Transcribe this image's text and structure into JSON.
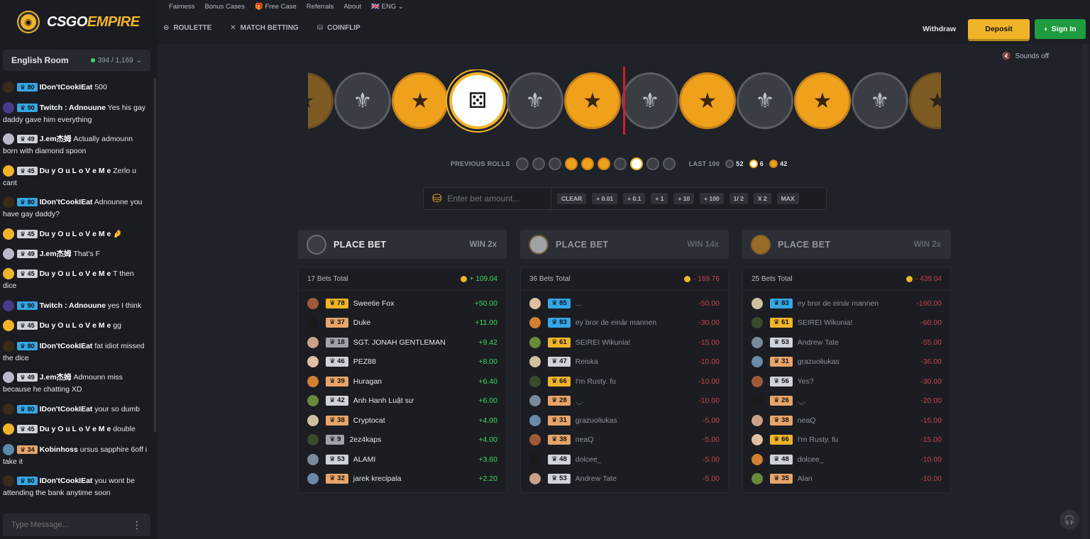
{
  "brand": {
    "name_a": "CSGO",
    "name_b": "EMPIRE"
  },
  "toplinks": [
    "Fairness",
    "Bonus Cases",
    "Free Case",
    "Referrals",
    "About",
    "ENG"
  ],
  "nav": {
    "roulette": "ROULETTE",
    "match_betting": "MATCH BETTING",
    "coinflip": "COINFLIP"
  },
  "header": {
    "withdraw": "Withdraw",
    "deposit": "Deposit",
    "signin": "Sign In"
  },
  "sounds": "Sounds off",
  "room": {
    "name": "English Room",
    "count": "394 / 1,169"
  },
  "chat": [
    {
      "level": "80",
      "badge_color": "#35a7e6",
      "user": "IDon'tCookIEat",
      "text": "500"
    },
    {
      "level": "90",
      "badge_color": "#35a7e6",
      "user": "Twitch : Adnouune",
      "text": "Yes his gay daddy gave him everything"
    },
    {
      "level": "49",
      "badge_color": "#cfd3db",
      "user": "J.em杰姆",
      "text": "Actually admounn born with diamond spoon"
    },
    {
      "level": "45",
      "badge_color": "#cfd3db",
      "user": "Du y O u L o V e M e",
      "text": "Zerlo u cant"
    },
    {
      "level": "80",
      "badge_color": "#35a7e6",
      "user": "IDon'tCookIEat",
      "text": "Adnounne you have gay daddy?"
    },
    {
      "level": "45",
      "badge_color": "#cfd3db",
      "user": "Du y O u L o V e M e",
      "text": "🤌"
    },
    {
      "level": "49",
      "badge_color": "#cfd3db",
      "user": "J.em杰姆",
      "text": "That's F"
    },
    {
      "level": "45",
      "badge_color": "#cfd3db",
      "user": "Du y O u L o V e M e",
      "text": "T then dice"
    },
    {
      "level": "90",
      "badge_color": "#35a7e6",
      "user": "Twitch : Adnouune",
      "text": "yes I think"
    },
    {
      "level": "45",
      "badge_color": "#cfd3db",
      "user": "Du y O u L o V e M e",
      "text": "gg"
    },
    {
      "level": "80",
      "badge_color": "#35a7e6",
      "user": "IDon'tCookIEat",
      "text": "fat idiot missed the dice"
    },
    {
      "level": "49",
      "badge_color": "#cfd3db",
      "user": "J.em杰姆",
      "text": "Admounn miss because he chatting XD"
    },
    {
      "level": "80",
      "badge_color": "#35a7e6",
      "user": "IDon'tCookIEat",
      "text": "your so dumb"
    },
    {
      "level": "45",
      "badge_color": "#cfd3db",
      "user": "Du y O u L o V e M e",
      "text": "double"
    },
    {
      "level": "34",
      "badge_color": "#e8a46a",
      "user": "Kobinhoss",
      "text": "ursus sapphire 6off i take it"
    },
    {
      "level": "80",
      "badge_color": "#35a7e6",
      "user": "IDon'tCookIEat",
      "text": "you wont be attending the bank anytime soon"
    }
  ],
  "chat_placeholder": "Type Message...",
  "roller": [
    "t",
    "ct",
    "t",
    "dice",
    "ct",
    "t",
    "ct",
    "t",
    "ct",
    "t",
    "ct",
    "t"
  ],
  "previous_rolls": {
    "label": "PREVIOUS ROLLS",
    "rolls": [
      "ct",
      "ct",
      "ct",
      "t",
      "t",
      "t",
      "ct",
      "d",
      "ct",
      "ct"
    ],
    "last100_label": "LAST 100",
    "ct": "52",
    "dice": "6",
    "t": "42"
  },
  "bet": {
    "placeholder": "Enter bet amount...",
    "buttons": [
      "CLEAR",
      "+ 0.01",
      "+ 0.1",
      "+ 1",
      "+ 10",
      "+ 100",
      "1/ 2",
      "X 2",
      "MAX"
    ]
  },
  "columns": [
    {
      "type": "ct",
      "label": "PLACE BET",
      "win": "WIN 2x",
      "total_label": "17 Bets Total",
      "total": "+ 109.04",
      "positive": true,
      "dim": false,
      "rows": [
        {
          "level": "78",
          "badge_color": "#f0b429",
          "name": "Sweetie Fox",
          "amount": "+50.00"
        },
        {
          "level": "37",
          "badge_color": "#e8a46a",
          "name": "Duke",
          "amount": "+11.00"
        },
        {
          "level": "18",
          "badge_color": "#9da2ab",
          "name": "SGT. JONAH GENTLEMAN",
          "amount": "+9.42"
        },
        {
          "level": "46",
          "badge_color": "#cfd3db",
          "name": "PEZ88",
          "amount": "+8.00"
        },
        {
          "level": "39",
          "badge_color": "#e8a46a",
          "name": "Huragan",
          "amount": "+6.40"
        },
        {
          "level": "42",
          "badge_color": "#cfd3db",
          "name": "Anh Hanh Luật sư",
          "amount": "+6.00"
        },
        {
          "level": "38",
          "badge_color": "#e8a46a",
          "name": "Cryptocat",
          "amount": "+4.00"
        },
        {
          "level": "9",
          "badge_color": "#9da2ab",
          "name": "2ez4kaps",
          "amount": "+4.00"
        },
        {
          "level": "53",
          "badge_color": "#cfd3db",
          "name": "ALAMI",
          "amount": "+3.60"
        },
        {
          "level": "32",
          "badge_color": "#e8a46a",
          "name": "jarek krecipala",
          "amount": "+2.20"
        }
      ]
    },
    {
      "type": "d",
      "label": "PLACE BET",
      "win": "WIN 14x",
      "total_label": "36 Bets Total",
      "total": "- 169.76",
      "positive": false,
      "dim": true,
      "rows": [
        {
          "level": "85",
          "badge_color": "#35a7e6",
          "name": "...",
          "amount": "-50.00"
        },
        {
          "level": "83",
          "badge_color": "#35a7e6",
          "name": "ey bror de einár mannen",
          "amount": "-30.00"
        },
        {
          "level": "61",
          "badge_color": "#f0b429",
          "name": "SEIREI Wikunia!",
          "amount": "-15.00"
        },
        {
          "level": "47",
          "badge_color": "#cfd3db",
          "name": "Reiska",
          "amount": "-10.00"
        },
        {
          "level": "66",
          "badge_color": "#f0b429",
          "name": "I'm Rusty. fu",
          "amount": "-10.00"
        },
        {
          "level": "28",
          "badge_color": "#e8a46a",
          "name": "._.",
          "amount": "-10.00"
        },
        {
          "level": "31",
          "badge_color": "#e8a46a",
          "name": "grazuoliukas",
          "amount": "-5.00"
        },
        {
          "level": "38",
          "badge_color": "#e8a46a",
          "name": "neaQ",
          "amount": "-5.00"
        },
        {
          "level": "48",
          "badge_color": "#cfd3db",
          "name": "dolcee_",
          "amount": "-5.00"
        },
        {
          "level": "53",
          "badge_color": "#cfd3db",
          "name": "Andrew Tate",
          "amount": "-5.00"
        }
      ]
    },
    {
      "type": "t",
      "label": "PLACE BET",
      "win": "WIN 2x",
      "total_label": "25 Bets Total",
      "total": "- 439.04",
      "positive": false,
      "dim": true,
      "rows": [
        {
          "level": "83",
          "badge_color": "#35a7e6",
          "name": "ey bror de einár mannen",
          "amount": "-160.00"
        },
        {
          "level": "61",
          "badge_color": "#f0b429",
          "name": "SEIREI Wikunia!",
          "amount": "-60.00"
        },
        {
          "level": "53",
          "badge_color": "#cfd3db",
          "name": "Andrew Tate",
          "amount": "-55.00"
        },
        {
          "level": "31",
          "badge_color": "#e8a46a",
          "name": "grazuoliukas",
          "amount": "-36.00"
        },
        {
          "level": "56",
          "badge_color": "#cfd3db",
          "name": "Yes?",
          "amount": "-30.00"
        },
        {
          "level": "26",
          "badge_color": "#e8a46a",
          "name": "._.",
          "amount": "-20.00"
        },
        {
          "level": "38",
          "badge_color": "#e8a46a",
          "name": "neaQ",
          "amount": "-15.00"
        },
        {
          "level": "66",
          "badge_color": "#f0b429",
          "name": "I'm Rusty. fu",
          "amount": "-15.00"
        },
        {
          "level": "48",
          "badge_color": "#cfd3db",
          "name": "dolcee_",
          "amount": "-10.00"
        },
        {
          "level": "35",
          "badge_color": "#e8a46a",
          "name": "Alan",
          "amount": "-10.00"
        }
      ]
    }
  ],
  "colors": {
    "accent": "#f0b429",
    "green": "#3ddc5c",
    "red": "#c9424b",
    "signin": "#1e9b3e"
  }
}
